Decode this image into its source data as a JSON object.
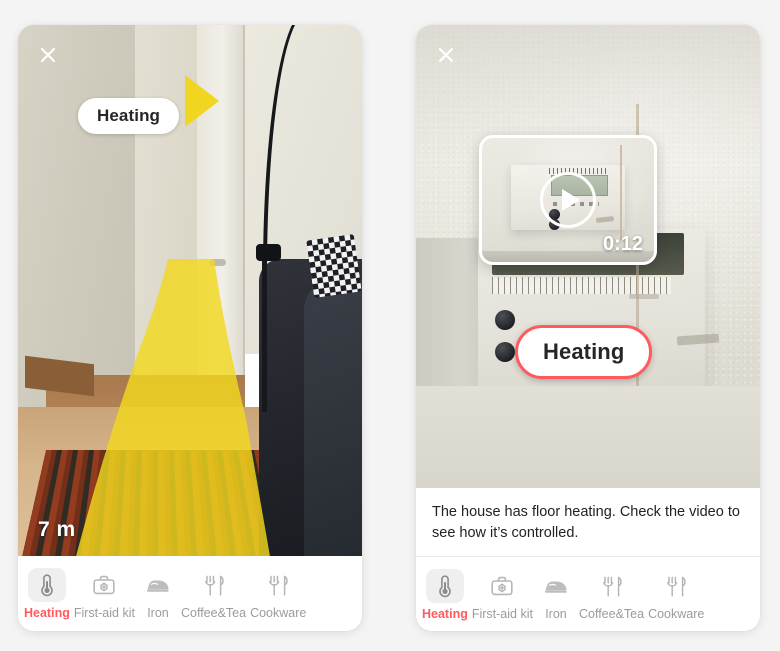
{
  "theme": {
    "accent": "#ff5a5f",
    "page_background": "#f4f4f4",
    "panel_background": "#ffffff",
    "ar_path_color": "#f0d621",
    "inactive_label": "#9b9b9b"
  },
  "panels": [
    {
      "id": "ar-navigation",
      "close_icon": "close-icon",
      "pill_label": "Heating",
      "arrow_icon": "direction-arrow-icon",
      "distance": "7 m"
    },
    {
      "id": "ar-detail",
      "close_icon": "close-icon",
      "pill_label": "Heating",
      "video": {
        "play_icon": "play-icon",
        "duration": "0:12"
      },
      "description": "The house has floor heating. Check the video to see how it’s controlled."
    }
  ],
  "tabbar": {
    "items": [
      {
        "label": "Heating",
        "icon": "thermometer-icon",
        "active": true
      },
      {
        "label": "First-aid kit",
        "icon": "first-aid-kit-icon",
        "active": false
      },
      {
        "label": "Iron",
        "icon": "iron-icon",
        "active": false
      },
      {
        "label": "Coffee&Tea",
        "icon": "cutlery-icon",
        "active": false
      },
      {
        "label": "Cookware",
        "icon": "cutlery-icon",
        "active": false
      }
    ]
  }
}
